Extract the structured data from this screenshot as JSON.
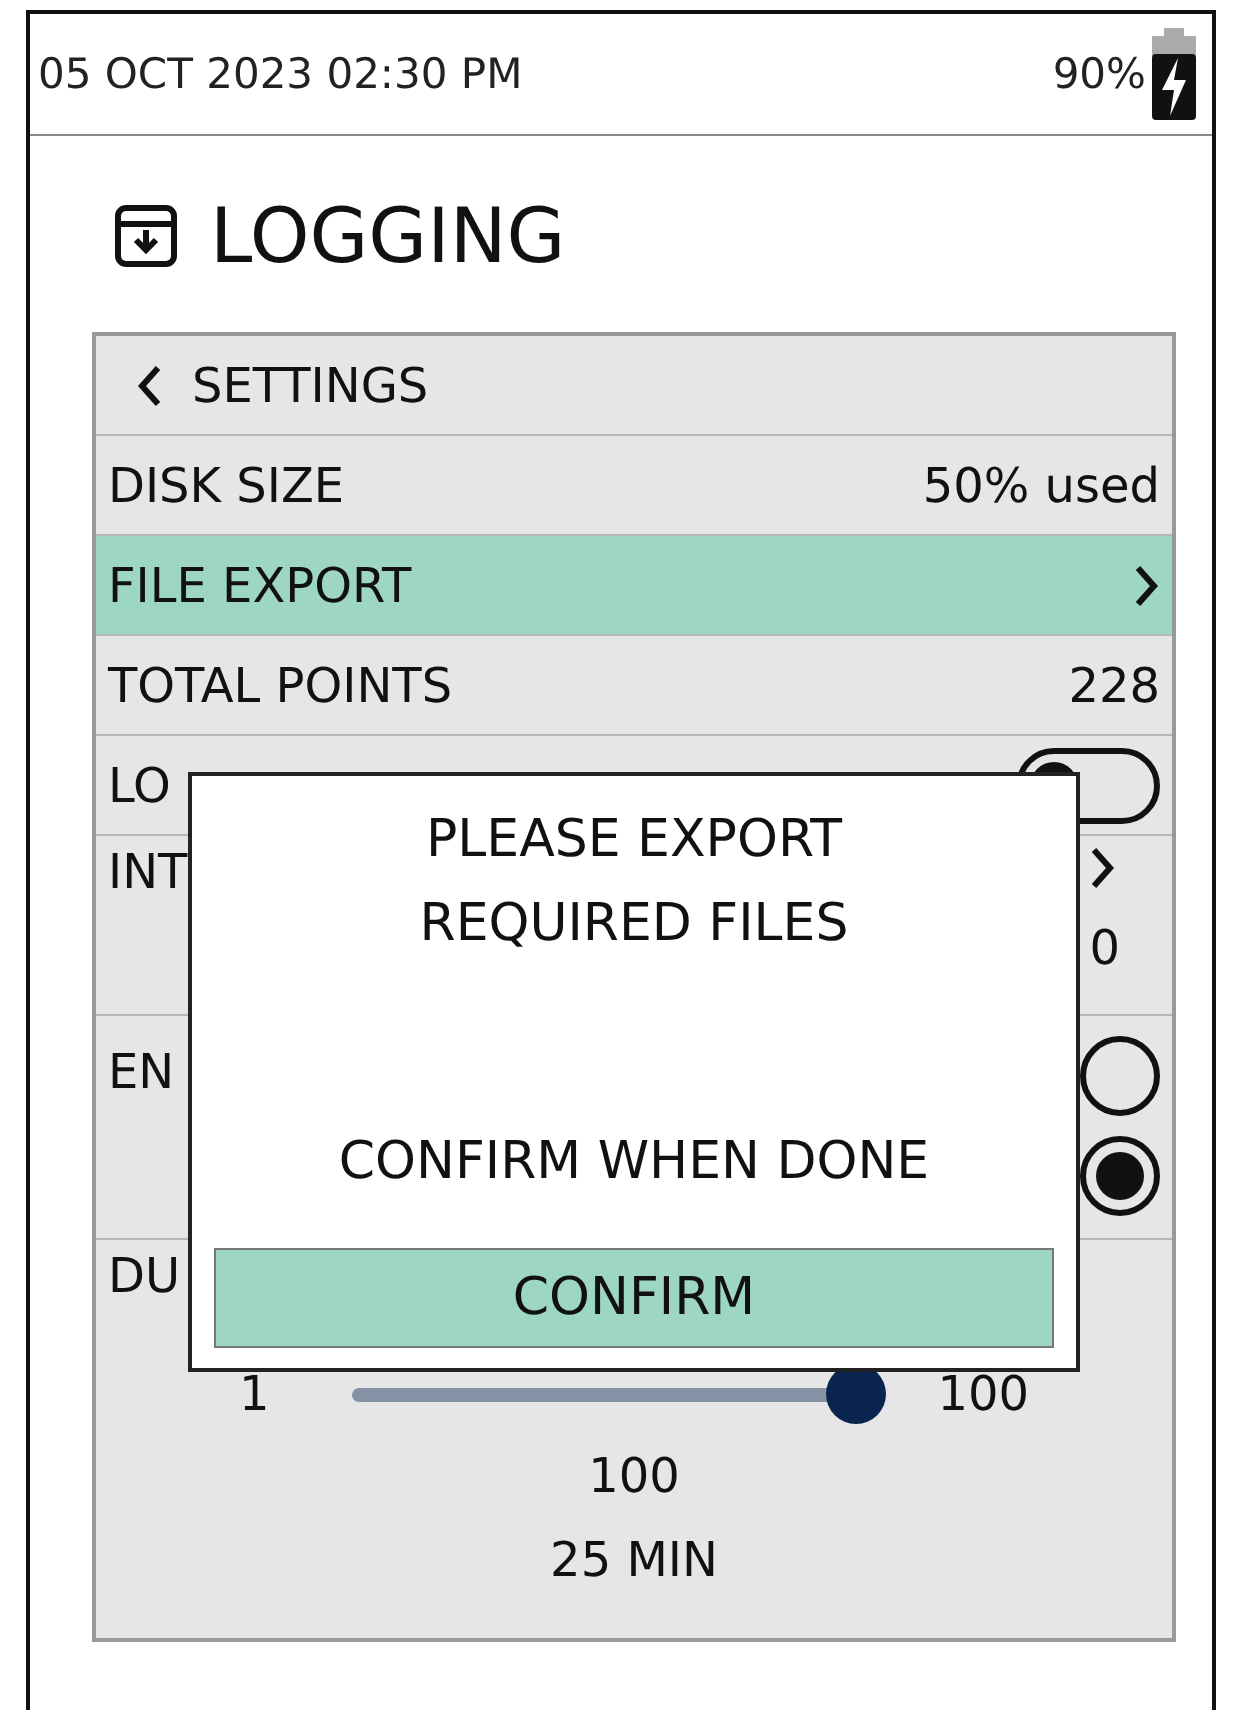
{
  "status_bar": {
    "datetime": "05 OCT 2023 02:30 PM",
    "battery": "90%"
  },
  "header": {
    "title": "LOGGING"
  },
  "menu": {
    "back": "SETTINGS",
    "rows": [
      {
        "kind": "value",
        "label": "DISK SIZE",
        "value": "50% used",
        "selected": false
      },
      {
        "kind": "link",
        "label": "FILE EXPORT",
        "selected": true
      },
      {
        "kind": "value",
        "label": "TOTAL POINTS",
        "value": "228",
        "selected": false
      },
      {
        "kind": "toggle",
        "label": "LO",
        "on": false,
        "selected": false
      },
      {
        "kind": "link_value",
        "label": "INT",
        "value": "0",
        "selected": false
      },
      {
        "kind": "radios",
        "label": "EN",
        "selected": false,
        "options": [
          {
            "selected": false
          },
          {
            "selected": true
          }
        ]
      },
      {
        "kind": "slider",
        "label": "DU",
        "min": "1",
        "max": "100",
        "level": 1.0,
        "value": "100",
        "duration": "25 MIN",
        "selected": false
      }
    ]
  },
  "dialog": {
    "message": "PLEASE EXPORT REQUIRED FILES",
    "prompt": "CONFIRM WHEN DONE",
    "button": "CONFIRM"
  }
}
